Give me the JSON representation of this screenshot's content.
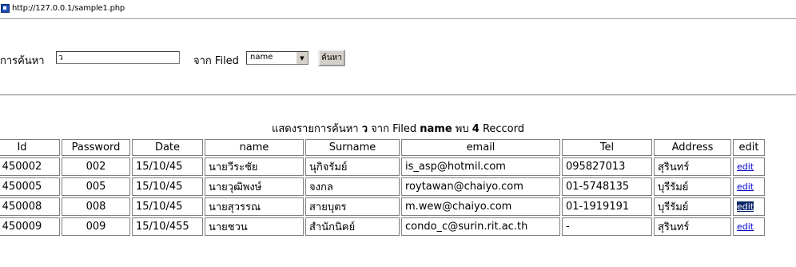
{
  "browser": {
    "url": "http://127.0.0.1/sample1.php"
  },
  "search": {
    "label": "การค้นหา",
    "input_value": "ว",
    "from_label": "จาก Filed",
    "field_value": "name",
    "button_label": "ค้นหา"
  },
  "summary": {
    "prefix": "แสดงรายการค้นหา",
    "term": "ว",
    "middle": "จาก Filed",
    "field": "name",
    "found_label": "พบ",
    "count": "4",
    "suffix": "Reccord"
  },
  "table": {
    "headers": [
      "Id",
      "Password",
      "Date",
      "name",
      "Surname",
      "email",
      "Tel",
      "Address",
      "edit"
    ],
    "rows": [
      {
        "id": "450002",
        "password": "002",
        "date": "15/10/45",
        "name": "นายวีระชัย",
        "surname": "นุกิจรัมย์",
        "email": "is_asp@hotmil.com",
        "tel": "095827013",
        "address": "สุรินทร์",
        "edit": "edit"
      },
      {
        "id": "450005",
        "password": "005",
        "date": "15/10/45",
        "name": "นายวุฒิพงษ์",
        "surname": "จงกล",
        "email": "roytawan@chaiyo.com",
        "tel": "01-5748135",
        "address": "บุรีรัมย์",
        "edit": "edit"
      },
      {
        "id": "450008",
        "password": "008",
        "date": "15/10/45",
        "name": "นายสุวรรณ",
        "surname": "สายบุตร",
        "email": "m.wew@chaiyo.com",
        "tel": "01-1919191",
        "address": "บุรีรัมย์",
        "edit": "edit"
      },
      {
        "id": "450009",
        "password": "009",
        "date": "15/10/455",
        "name": "นายชวน",
        "surname": "สำนักนิคย์",
        "email": "condo_c@surin.rit.ac.th",
        "tel": "-",
        "address": "สุรินทร์",
        "edit": "edit"
      }
    ]
  },
  "colors": {
    "link": "#0000cc",
    "selection": "#0a246a",
    "border": "#808080"
  }
}
